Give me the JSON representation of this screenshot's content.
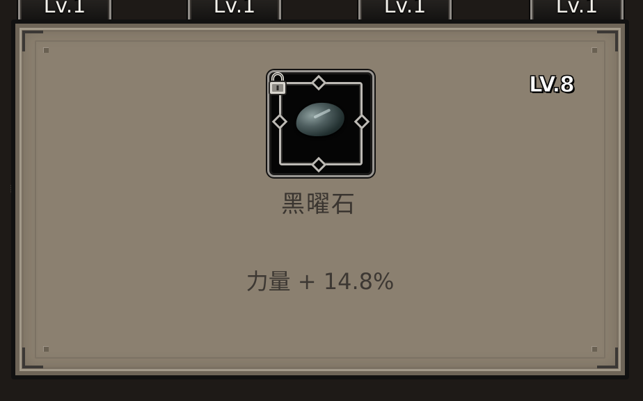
{
  "top_tabs": [
    {
      "label": "Lv.1"
    },
    {
      "label": "Lv.1"
    },
    {
      "label": "Lv.1"
    },
    {
      "label": "Lv.1"
    }
  ],
  "item": {
    "name": "黑曜石",
    "level": "LV.8",
    "stat": "力量 + 14.8%",
    "icon": "obsidian-stone-icon",
    "locked": true
  },
  "colors": {
    "panel": "#8b8070",
    "frame": "#111111",
    "text": "#3a3530",
    "level_text": "#ffffff"
  }
}
